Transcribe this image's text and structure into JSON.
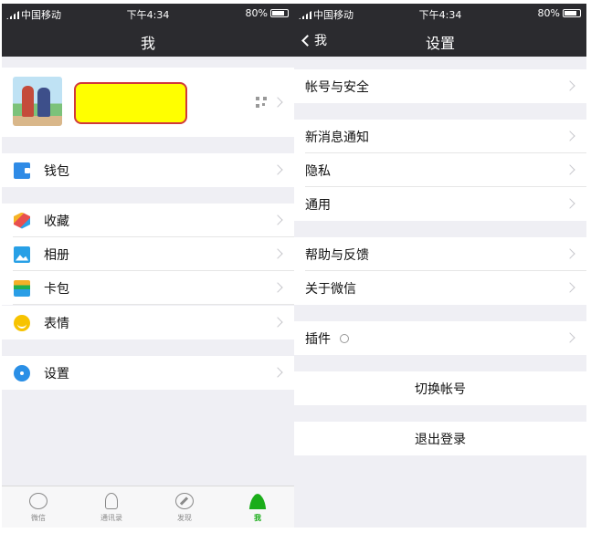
{
  "status": {
    "carrier": "中国移动",
    "time": "下午4:34",
    "battery": "80%"
  },
  "left": {
    "title": "我",
    "menu": {
      "wallet": "钱包",
      "favorites": "收藏",
      "album": "相册",
      "cards": "卡包",
      "stickers": "表情",
      "settings": "设置"
    },
    "tabs": [
      {
        "label": "微信",
        "icon": "chat-icon"
      },
      {
        "label": "通讯录",
        "icon": "contacts-icon"
      },
      {
        "label": "发现",
        "icon": "discover-icon"
      },
      {
        "label": "我",
        "icon": "me-icon",
        "active": true
      }
    ]
  },
  "right": {
    "back": "我",
    "title": "设置",
    "items": {
      "account_security": "帐号与安全",
      "notifications": "新消息通知",
      "privacy": "隐私",
      "general": "通用",
      "help": "帮助与反馈",
      "about": "关于微信",
      "plugins": "插件",
      "switch_account": "切换帐号",
      "logout": "退出登录"
    }
  },
  "colors": {
    "header": "#2b2b2f",
    "background": "#efeff4",
    "active_tab": "#1aad19",
    "redaction": "#ffff00"
  }
}
